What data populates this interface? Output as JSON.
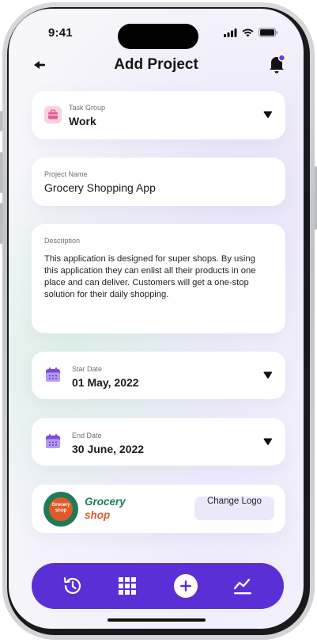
{
  "status": {
    "time": "9:41"
  },
  "header": {
    "title": "Add Project"
  },
  "task_group": {
    "label": "Task Group",
    "value": "Work"
  },
  "project_name": {
    "label": "Project Name",
    "value": "Grocery Shopping App"
  },
  "description": {
    "label": "Description",
    "lines": [
      "This application is designed for super shops. By using",
      "this application they can enlist all their products in one",
      "place and can deliver. Customers will get a one-stop",
      "solution for their daily shopping."
    ]
  },
  "start_date": {
    "label": "Star Date",
    "value": "01 May, 2022"
  },
  "end_date": {
    "label": "End Date",
    "value": "30 June, 2022"
  },
  "logo": {
    "badge_text": "Grocery shop",
    "name_line1": "Grocery",
    "name_line2": "shop",
    "button_label": "Change Logo"
  },
  "colors": {
    "accent": "#5b2fd6",
    "task_icon_bg": "#f7c6dc",
    "task_icon": "#e25b95",
    "calendar_icon": "#7a4be0",
    "logo_green": "#1f7a5a",
    "logo_orange": "#e0592a"
  },
  "nav": {
    "items": [
      {
        "icon": "history-icon"
      },
      {
        "icon": "grid-icon"
      },
      {
        "icon": "add-icon"
      },
      {
        "icon": "chart-icon"
      }
    ]
  }
}
